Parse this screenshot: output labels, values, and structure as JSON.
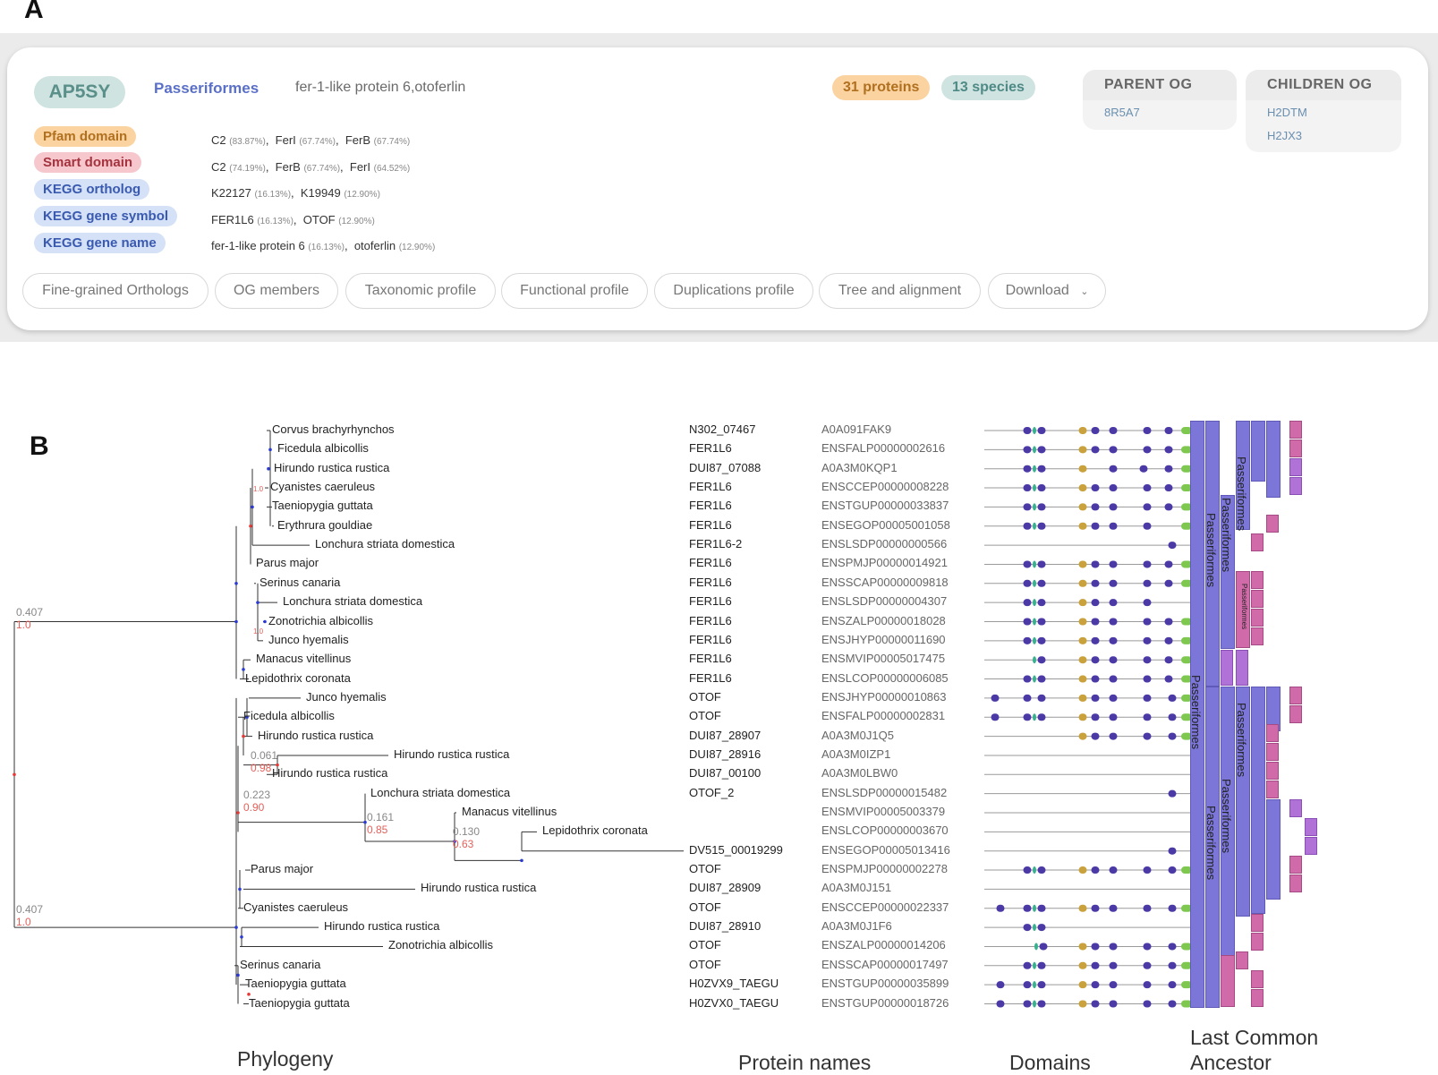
{
  "panels": {
    "a": "A",
    "b": "B"
  },
  "header": {
    "og_id": "AP5SY",
    "taxon": "Passeriformes",
    "description": "fer-1-like protein 6,otoferlin",
    "proteins": "31 proteins",
    "species": "13 species"
  },
  "parent_og": {
    "title": "PARENT OG",
    "items": [
      "8R5A7"
    ]
  },
  "children_og": {
    "title": "CHILDREN OG",
    "items": [
      "H2DTM",
      "H2JX3"
    ]
  },
  "annotations": [
    {
      "label": "Pfam domain",
      "values": [
        [
          "C2",
          "(83.87%)"
        ],
        [
          "FerI",
          "(67.74%)"
        ],
        [
          "FerB",
          "(67.74%)"
        ]
      ]
    },
    {
      "label": "Smart domain",
      "values": [
        [
          "C2",
          "(74.19%)"
        ],
        [
          "FerB",
          "(67.74%)"
        ],
        [
          "FerI",
          "(64.52%)"
        ]
      ]
    },
    {
      "label": "KEGG ortholog",
      "values": [
        [
          "K22127",
          "(16.13%)"
        ],
        [
          "K19949",
          "(12.90%)"
        ]
      ]
    },
    {
      "label": "KEGG gene symbol",
      "values": [
        [
          "FER1L6",
          "(16.13%)"
        ],
        [
          "OTOF",
          "(12.90%)"
        ]
      ]
    },
    {
      "label": "KEGG gene name",
      "values": [
        [
          "fer-1-like protein 6",
          "(16.13%)"
        ],
        [
          "otoferlin",
          "(12.90%)"
        ]
      ]
    }
  ],
  "tabs": [
    "Fine-grained Orthologs",
    "OG members",
    "Taxonomic profile",
    "Functional profile",
    "Duplications profile",
    "Tree and alignment",
    "Download"
  ],
  "tree": {
    "leaves": [
      {
        "species": "Corvus brachyrhynchos",
        "name": "N302_07467",
        "acc": "A0A091FAK9"
      },
      {
        "species": "Ficedula albicollis",
        "name": "FER1L6",
        "acc": "ENSFALP00000002616"
      },
      {
        "species": "Hirundo rustica rustica",
        "name": "DUI87_07088",
        "acc": "A0A3M0KQP1"
      },
      {
        "species": "Cyanistes caeruleus",
        "name": "FER1L6",
        "acc": "ENSCCEP00000008228"
      },
      {
        "species": "Taeniopygia guttata",
        "name": "FER1L6",
        "acc": "ENSTGUP00000033837"
      },
      {
        "species": "Erythrura gouldiae",
        "name": "FER1L6",
        "acc": "ENSEGOP00005001058"
      },
      {
        "species": "Lonchura striata domestica",
        "name": "FER1L6-2",
        "acc": "ENSLSDP00000000566"
      },
      {
        "species": "Parus major",
        "name": "FER1L6",
        "acc": "ENSPMJP00000014921"
      },
      {
        "species": "Serinus canaria",
        "name": "FER1L6",
        "acc": "ENSSCAP00000009818"
      },
      {
        "species": "Lonchura striata domestica",
        "name": "FER1L6",
        "acc": "ENSLSDP00000004307"
      },
      {
        "species": "Zonotrichia albicollis",
        "name": "FER1L6",
        "acc": "ENSZALP00000018028"
      },
      {
        "species": "Junco hyemalis",
        "name": "FER1L6",
        "acc": "ENSJHYP00000011690"
      },
      {
        "species": "Manacus vitellinus",
        "name": "FER1L6",
        "acc": "ENSMVIP00005017475"
      },
      {
        "species": "Lepidothrix coronata",
        "name": "FER1L6",
        "acc": "ENSLCOP00000006085"
      },
      {
        "species": "Junco hyemalis",
        "name": "OTOF",
        "acc": "ENSJHYP00000010863"
      },
      {
        "species": "Ficedula albicollis",
        "name": "OTOF",
        "acc": "ENSFALP00000002831"
      },
      {
        "species": "Hirundo rustica rustica",
        "name": "DUI87_28907",
        "acc": "A0A3M0J1Q5"
      },
      {
        "species": "Hirundo rustica rustica",
        "name": "DUI87_28916",
        "acc": "A0A3M0IZP1"
      },
      {
        "species": "Hirundo rustica rustica",
        "name": "DUI87_00100",
        "acc": "A0A3M0LBW0"
      },
      {
        "species": "Lonchura striata domestica",
        "name": "OTOF_2",
        "acc": "ENSLSDP00000015482"
      },
      {
        "species": "Manacus vitellinus",
        "name": "",
        "acc": "ENSMVIP00005003379"
      },
      {
        "species": "Lepidothrix coronata",
        "name": "",
        "acc": "ENSLCOP00000003670"
      },
      {
        "species": "",
        "name": "DV515_00019299",
        "acc": "ENSEGOP00005013416"
      },
      {
        "species": "Parus major",
        "name": "OTOF",
        "acc": "ENSPMJP00000002278"
      },
      {
        "species": "Hirundo rustica rustica",
        "name": "DUI87_28909",
        "acc": "A0A3M0J151"
      },
      {
        "species": "Cyanistes caeruleus",
        "name": "OTOF",
        "acc": "ENSCCEP00000022337"
      },
      {
        "species": "Hirundo rustica rustica",
        "name": "DUI87_28910",
        "acc": "A0A3M0J1F6"
      },
      {
        "species": "Zonotrichia albicollis",
        "name": "OTOF",
        "acc": "ENSZALP00000014206"
      },
      {
        "species": "Serinus canaria",
        "name": "OTOF",
        "acc": "ENSSCAP00000017497"
      },
      {
        "species": "Taeniopygia guttata",
        "name": "H0ZVX9_TAEGU",
        "acc": "ENSTGUP00000035899"
      },
      {
        "species": "Taeniopygia guttata",
        "name": "H0ZVX0_TAEGU",
        "acc": "ENSTGUP00000018726"
      }
    ],
    "branch_labels": [
      {
        "dist": "0.407",
        "support": "1.0"
      },
      {
        "dist": "0.407",
        "support": "1.0"
      },
      {
        "dist": "0.061",
        "support": "0.98"
      },
      {
        "dist": "0.223",
        "support": "0.90"
      },
      {
        "dist": "0.161",
        "support": "0.85"
      },
      {
        "dist": "0.130",
        "support": "0.63"
      }
    ],
    "small_support": [
      "1.0",
      "1.0"
    ]
  },
  "lca_label": "Passeriformes",
  "footer": {
    "phylogeny": "Phylogeny",
    "protein_names": "Protein names",
    "domains": "Domains",
    "lca": "Last Common Ancestor"
  },
  "colors": {
    "domain_purple": "#4b3aa6",
    "domain_green": "#7ec850",
    "domain_gold": "#c9a13d",
    "domain_teal": "#3ab08f",
    "lca": "#7b76d8",
    "pink": "#d06aa8",
    "red_node": "#e53935",
    "blue_node": "#2b3bd1"
  }
}
